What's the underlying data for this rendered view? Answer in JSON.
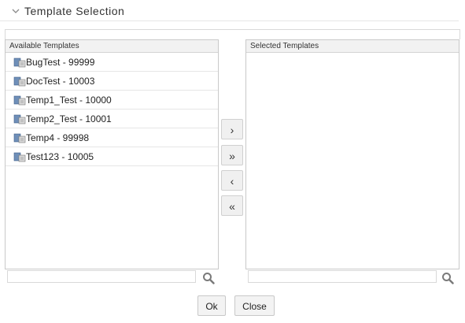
{
  "section": {
    "title": "Template Selection"
  },
  "available": {
    "header": "Available Templates",
    "items": [
      {
        "label": "BugTest - 99999"
      },
      {
        "label": "DocTest - 10003"
      },
      {
        "label": "Temp1_Test - 10000"
      },
      {
        "label": "Temp2_Test - 10001"
      },
      {
        "label": "Temp4 - 99998"
      },
      {
        "label": "Test123 - 10005"
      }
    ]
  },
  "selected": {
    "header": "Selected Templates",
    "items": []
  },
  "move_buttons": {
    "move_right": "›",
    "move_all_right": "»",
    "move_left": "‹",
    "move_all_left": "«"
  },
  "search": {
    "available_value": "",
    "selected_value": ""
  },
  "footer": {
    "ok_label": "Ok",
    "close_label": "Close"
  },
  "icons": {
    "section_toggle": "chevron-down-icon",
    "template_item": "template-icon",
    "search": "search-icon"
  }
}
